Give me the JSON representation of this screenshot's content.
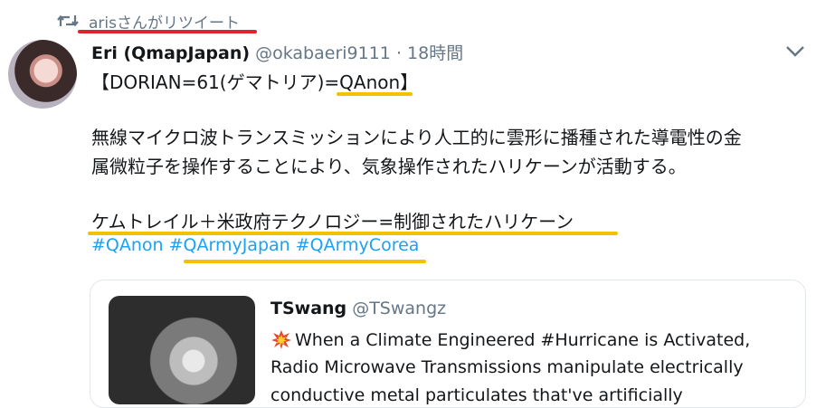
{
  "retweet": {
    "user": "aris",
    "text": "さんがリツイート",
    "icon": "retweet-icon"
  },
  "tweet": {
    "author_name": "Eri (QmapJapan)",
    "handle": "@okabaeri9111",
    "separator": "·",
    "time": "18時間",
    "line1_prefix": "【DORIAN=61(ゲマトリア)",
    "line1_highlight": "=QAnon",
    "line1_suffix": "】",
    "paragraph_line1": "無線マイクロ波トランスミッションにより人工的に雲形に播種された導電性の金",
    "paragraph_line2": "属微粒子を操作することにより、気象操作されたハリケーンが活動する。",
    "equation_line": "ケムトレイル＋米政府テクノロジー=制御されたハリケーン",
    "hashtags": [
      "#QAnon",
      "#QArmyJapan",
      "#QArmyCorea"
    ]
  },
  "quoted": {
    "name": "TSwang",
    "handle": "@TSwangz",
    "line1": "When a Climate Engineered #Hurricane is Activated,",
    "line2": "Radio Microwave Transmissions manipulate electrically",
    "line3": "conductive metal particulates that've artificially",
    "emoji": "collision-icon"
  },
  "colors": {
    "link": "#1da1f2",
    "secondary": "#657786",
    "red_underline": "#e0242b",
    "yellow_underline": "#f2c200"
  }
}
